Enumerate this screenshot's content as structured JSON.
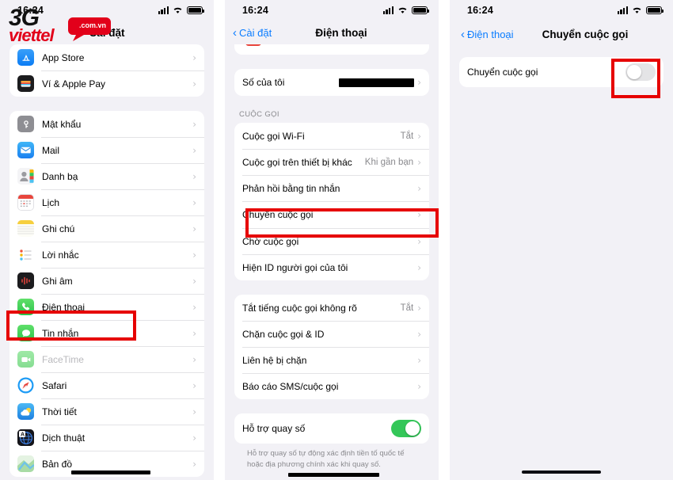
{
  "meta": {
    "accent_red": "#e60000",
    "ios_blue": "#0a7cff",
    "toggle_green": "#34c759",
    "bg_gray": "#f2f1f6"
  },
  "watermark": {
    "brand_3g": "3G",
    "brand_viettel": "viettel",
    "bubble_text": ".com.vn"
  },
  "panels": {
    "left": {
      "statusbar": {
        "time": "16:24",
        "cellular_icon": "cellular-bars-icon",
        "wifi_icon": "wifi-icon",
        "battery_icon": "battery-icon"
      },
      "nav": {
        "title": "Cài đặt"
      },
      "groups": [
        {
          "header": "",
          "rows": [
            {
              "label": "App Store",
              "icon": "app-store-icon"
            },
            {
              "label": "Ví & Apple Pay",
              "icon": "wallet-apple-pay-icon"
            }
          ]
        },
        {
          "header": "",
          "rows": [
            {
              "label": "Mật khẩu",
              "icon": "passwords-key-icon"
            },
            {
              "label": "Mail",
              "icon": "mail-icon"
            },
            {
              "label": "Danh bạ",
              "icon": "contacts-icon"
            },
            {
              "label": "Lịch",
              "icon": "calendar-icon"
            },
            {
              "label": "Ghi chú",
              "icon": "notes-icon"
            },
            {
              "label": "Lời nhắc",
              "icon": "reminders-icon"
            },
            {
              "label": "Ghi âm",
              "icon": "voice-memos-icon"
            },
            {
              "label": "Điện thoại",
              "icon": "phone-icon",
              "highlighted": true
            },
            {
              "label": "Tin nhắn",
              "icon": "messages-icon"
            },
            {
              "label": "FaceTime",
              "icon": "facetime-icon",
              "dimmed": true
            },
            {
              "label": "Safari",
              "icon": "safari-icon"
            },
            {
              "label": "Thời tiết",
              "icon": "weather-icon"
            },
            {
              "label": "Dịch thuật",
              "icon": "translate-icon"
            },
            {
              "label": "Bản đồ",
              "icon": "maps-icon"
            }
          ]
        }
      ]
    },
    "mid": {
      "statusbar": {
        "time": "16:24"
      },
      "nav": {
        "back_label": "Cài đặt",
        "title": "Điện thoại"
      },
      "groups": [
        {
          "header": "",
          "rows": [
            {
              "label": "Số của tôi",
              "value_redacted": true
            }
          ]
        },
        {
          "header": "Cuộc gọi",
          "rows": [
            {
              "label": "Cuộc gọi Wi-Fi",
              "value": "Tắt"
            },
            {
              "label": "Cuộc gọi trên thiết bị khác",
              "value": "Khi gần bạn"
            },
            {
              "label": "Phản hồi bằng tin nhắn",
              "value": ""
            },
            {
              "label": "Chuyển cuộc gọi",
              "value": "",
              "highlighted": true
            },
            {
              "label": "Chờ cuộc gọi",
              "value": ""
            },
            {
              "label": "Hiện ID người gọi của tôi",
              "value": ""
            }
          ]
        },
        {
          "header": "",
          "rows": [
            {
              "label": "Tắt tiếng cuộc gọi không rõ",
              "value": "Tắt"
            },
            {
              "label": "Chặn cuộc gọi & ID",
              "value": ""
            },
            {
              "label": "Liên hệ bị chặn",
              "value": ""
            },
            {
              "label": "Báo cáo SMS/cuộc gọi",
              "value": ""
            }
          ]
        },
        {
          "header": "",
          "rows": [
            {
              "label": "Hỗ trợ quay số",
              "toggle": "on"
            }
          ],
          "footnote": "Hỗ trợ quay số tự động xác định tiền tố quốc tế hoặc địa phương chính xác khi quay số."
        }
      ]
    },
    "right": {
      "statusbar": {
        "time": "16:24"
      },
      "nav": {
        "back_label": "Điện thoại",
        "title": "Chuyển cuộc gọi"
      },
      "groups": [
        {
          "header": "",
          "rows": [
            {
              "label": "Chuyển cuộc gọi",
              "toggle": "off",
              "highlighted": true
            }
          ]
        }
      ]
    }
  }
}
